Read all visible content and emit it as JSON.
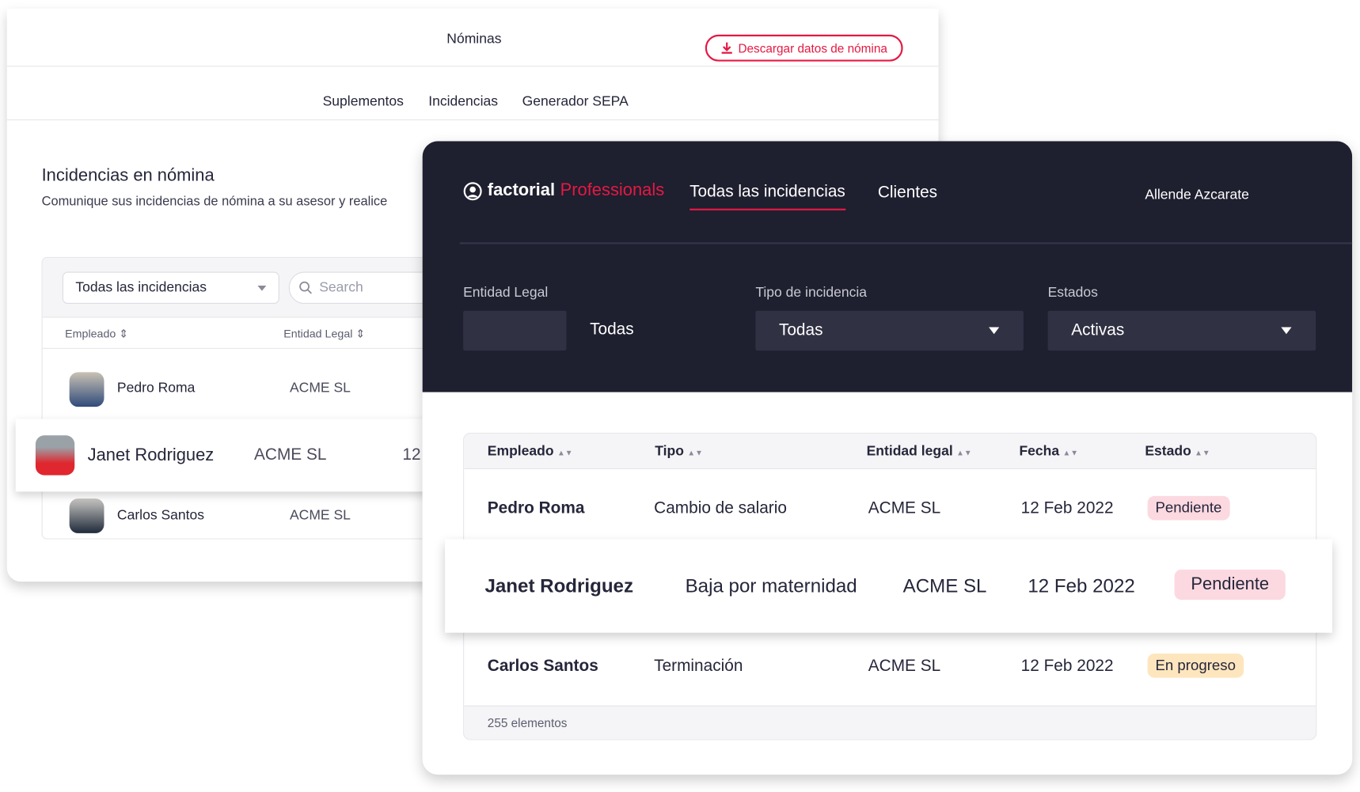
{
  "back": {
    "title": "Nóminas",
    "download_button": "Descargar datos de nómina",
    "tabs": [
      "Suplementos",
      "Incidencias",
      "Generador SEPA"
    ],
    "heading": "Incidencias en nómina",
    "subheading": "Comunique sus incidencias de nómina a su asesor y realice",
    "filter_select": "Todas las incidencias",
    "search_placeholder": "Search",
    "columns": [
      "Empleado",
      "Entidad Legal"
    ],
    "rows": [
      {
        "name": "Pedro Roma",
        "entity": "ACME SL"
      },
      {
        "name": "Janet Rodriguez",
        "entity": "ACME SL",
        "date_partial": "12"
      },
      {
        "name": "Carlos Santos",
        "entity": "ACME SL"
      }
    ]
  },
  "front": {
    "logo_word": "factorial",
    "logo_product": "Professionals",
    "nav": [
      "Todas las incidencias",
      "Clientes"
    ],
    "user": "Allende Azcarate",
    "filters": [
      {
        "label": "Entidad Legal",
        "value": "Todas"
      },
      {
        "label": "Tipo de incidencia",
        "value": "Todas"
      },
      {
        "label": "Estados",
        "value": "Activas"
      }
    ],
    "columns": [
      "Empleado",
      "Tipo",
      "Entidad legal",
      "Fecha",
      "Estado"
    ],
    "rows": [
      {
        "name": "Pedro Roma",
        "type": "Cambio de salario",
        "entity": "ACME SL",
        "date": "12 Feb 2022",
        "status": "Pendiente"
      },
      {
        "name": "Janet Rodriguez",
        "type": "Baja por maternidad",
        "entity": "ACME SL",
        "date": "12 Feb 2022",
        "status": "Pendiente"
      },
      {
        "name": "Carlos Santos",
        "type": "Terminación",
        "entity": "ACME SL",
        "date": "12 Feb 2022",
        "status": "En progreso"
      }
    ],
    "footer": "255 elementos"
  },
  "colors": {
    "accent": "#e51943",
    "dark": "#1e1f2f",
    "pending": "#fcd9e1",
    "progress": "#fde6be"
  }
}
